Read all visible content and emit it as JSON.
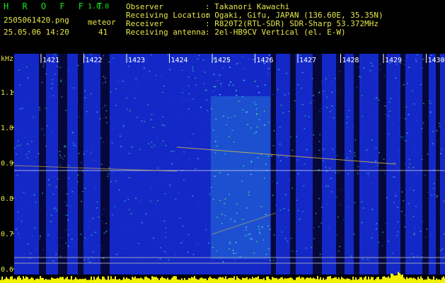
{
  "app": {
    "title": "H R O F F T",
    "version": "1.0.0"
  },
  "file": {
    "name": "2505061420.png",
    "datetime": "25.05.06 14:20"
  },
  "meteor": {
    "label": "meteor",
    "count": "41"
  },
  "station": [
    {
      "label": "Observer",
      "value": ": Takanori Kawachi"
    },
    {
      "label": "Receiving Location",
      "value": ": Ogaki, Gifu, JAPAN (136.60E, 35.35N)"
    },
    {
      "label": "Receiver",
      "value": ": R820T2(RTL-SDR) SDR-Sharp 53.372MHz"
    },
    {
      "label": "Receiving antenna",
      "value": ": 2el-HB9CV Vertical (el. E-W)"
    }
  ],
  "axis": {
    "unit": "kHz",
    "freq_ticks": [
      "1.1",
      "1.0",
      "0.9",
      "0.8",
      "0.7",
      "0.6"
    ],
    "time_ticks": [
      "1421",
      "1422",
      "1423",
      "1424",
      "1425",
      "1426",
      "1427",
      "1428",
      "1429",
      "1430"
    ]
  },
  "colors": {
    "header_text": "#e6e64d",
    "title_green": "#19e619",
    "background": "#000000",
    "spectrogram_base": "#1428c8",
    "signal_line": "#e6e6e6",
    "level_bar": "#f0f000"
  }
}
